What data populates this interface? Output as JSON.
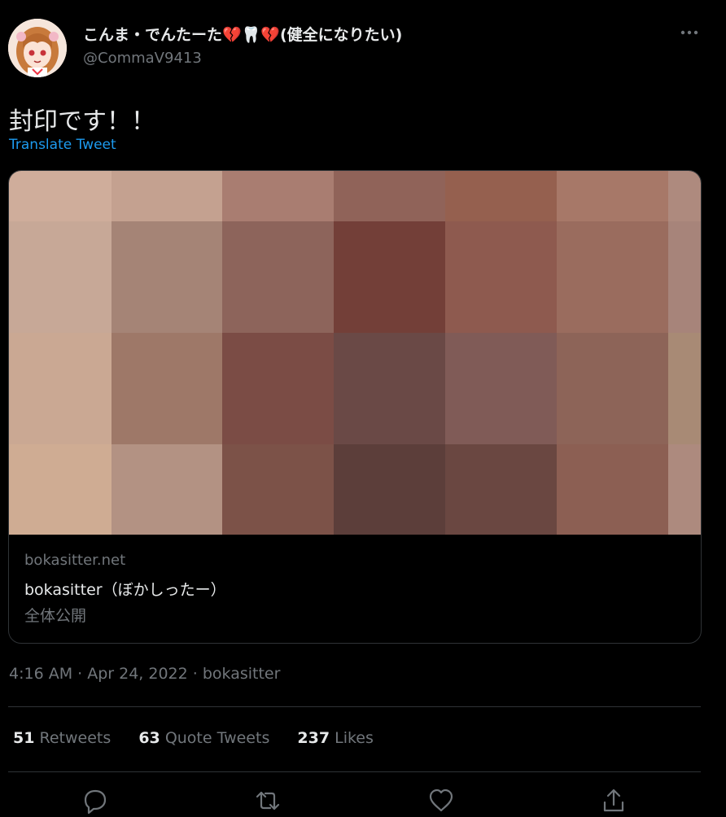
{
  "tweet": {
    "display_name": "こんま・でんたーた💔🦷💔(健全になりたい)",
    "handle": "@CommaV9413",
    "text": "封印です！！",
    "translate_label": "Translate Tweet",
    "timestamp": "4:16 AM · Apr 24, 2022 · bokasitter"
  },
  "card": {
    "domain": "bokasitter.net",
    "title": "bokasitter（ぼかしったー）",
    "description": "全体公開",
    "mosaic_colors": [
      [
        "#cfad9b",
        "#c4a190",
        "#a97d71",
        "#906359",
        "#95604f",
        "#a77868",
        "#ae8a7e"
      ],
      [
        "#c7a897",
        "#a58476",
        "#8d645b",
        "#733f38",
        "#8e5a4f",
        "#9a6c5e",
        "#a7847a"
      ],
      [
        "#caa893",
        "#9e7868",
        "#7b4c45",
        "#6a4946",
        "#805b57",
        "#8d6458",
        "#a88a75"
      ],
      [
        "#cfac93",
        "#b39283",
        "#7c5248",
        "#5c3e3a",
        "#6a4741",
        "#8c5f53",
        "#ad8a7e"
      ]
    ]
  },
  "stats": {
    "retweets_count": "51",
    "retweets_label": "Retweets",
    "quotes_count": "63",
    "quotes_label": "Quote Tweets",
    "likes_count": "237",
    "likes_label": "Likes"
  },
  "icons": {
    "more": "more-horizontal-icon",
    "reply": "reply-icon",
    "retweet": "retweet-icon",
    "like": "heart-icon",
    "share": "share-icon"
  },
  "colors": {
    "background": "#000000",
    "text": "#e7e9ea",
    "secondary": "#71767b",
    "link": "#1d9bf0",
    "border": "#2f3336"
  }
}
